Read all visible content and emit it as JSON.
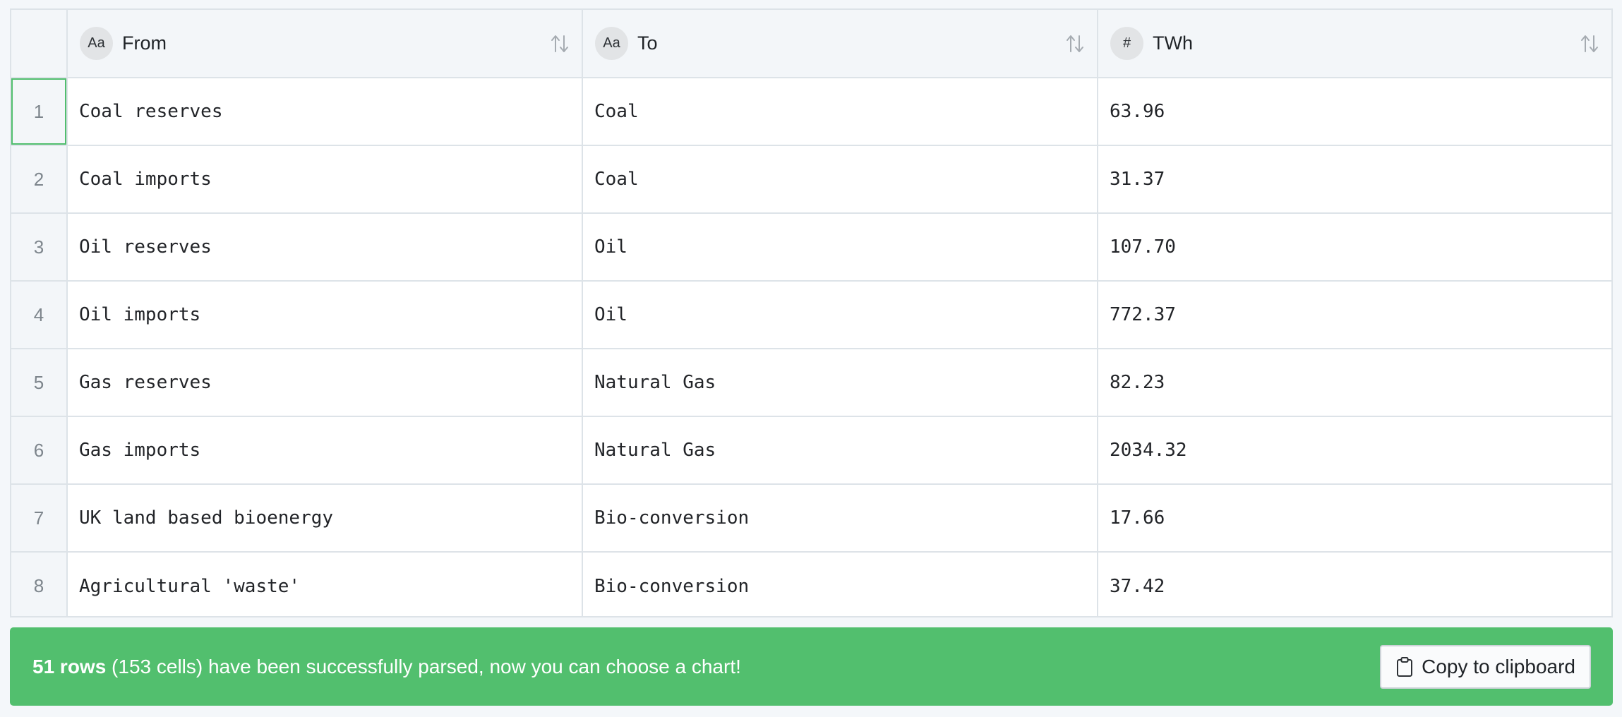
{
  "table": {
    "columns": [
      {
        "label": "From",
        "type_icon": "text-type-icon",
        "type_glyph": "Aa"
      },
      {
        "label": "To",
        "type_icon": "text-type-icon",
        "type_glyph": "Aa"
      },
      {
        "label": "TWh",
        "type_icon": "number-type-icon",
        "type_glyph": "#"
      }
    ],
    "rows": [
      {
        "index": "1",
        "from": "Coal reserves",
        "to": "Coal",
        "twh": "63.96"
      },
      {
        "index": "2",
        "from": "Coal imports",
        "to": "Coal",
        "twh": "31.37"
      },
      {
        "index": "3",
        "from": "Oil reserves",
        "to": "Oil",
        "twh": "107.70"
      },
      {
        "index": "4",
        "from": "Oil imports",
        "to": "Oil",
        "twh": "772.37"
      },
      {
        "index": "5",
        "from": "Gas reserves",
        "to": "Natural Gas",
        "twh": "82.23"
      },
      {
        "index": "6",
        "from": "Gas imports",
        "to": "Natural Gas",
        "twh": "2034.32"
      },
      {
        "index": "7",
        "from": "UK land based bioenergy",
        "to": "Bio-conversion",
        "twh": "17.66"
      },
      {
        "index": "8",
        "from": "Agricultural 'waste'",
        "to": "Bio-conversion",
        "twh": "37.42"
      }
    ]
  },
  "status": {
    "row_count": "51 rows",
    "message": " (153 cells) have been successfully parsed, now you can choose a chart!",
    "copy_label": "Copy to clipboard",
    "color": "#52bf6e"
  },
  "selection": {
    "accent": "#51be6e"
  }
}
